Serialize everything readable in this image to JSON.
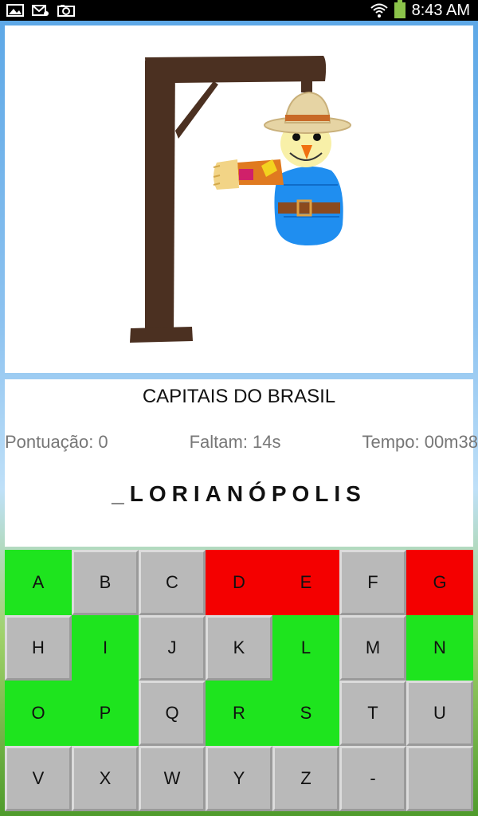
{
  "status_bar": {
    "time": "8:43 AM",
    "icons": [
      "image-icon",
      "mail-icon",
      "camera-icon",
      "wifi-icon",
      "battery-icon"
    ]
  },
  "game": {
    "category": "CAPITAIS DO BRASIL",
    "score_label": "Pontuação: 0",
    "remaining_label": "Faltam: 14s",
    "time_label": "Tempo: 00m38",
    "word": "_LORIANÓPOLIS"
  },
  "colors": {
    "correct": "#1ee41e",
    "wrong": "#f40000",
    "unused": "#b9b9b9"
  },
  "keyboard": {
    "keys": [
      {
        "label": "A",
        "state": "correct"
      },
      {
        "label": "B",
        "state": "unused"
      },
      {
        "label": "C",
        "state": "unused"
      },
      {
        "label": "D",
        "state": "wrong"
      },
      {
        "label": "E",
        "state": "wrong"
      },
      {
        "label": "F",
        "state": "unused"
      },
      {
        "label": "G",
        "state": "wrong"
      },
      {
        "label": "H",
        "state": "unused"
      },
      {
        "label": "I",
        "state": "correct"
      },
      {
        "label": "J",
        "state": "unused"
      },
      {
        "label": "K",
        "state": "unused"
      },
      {
        "label": "L",
        "state": "correct"
      },
      {
        "label": "M",
        "state": "unused"
      },
      {
        "label": "N",
        "state": "correct"
      },
      {
        "label": "O",
        "state": "correct"
      },
      {
        "label": "P",
        "state": "correct"
      },
      {
        "label": "Q",
        "state": "unused"
      },
      {
        "label": "R",
        "state": "correct"
      },
      {
        "label": "S",
        "state": "correct"
      },
      {
        "label": "T",
        "state": "unused"
      },
      {
        "label": "U",
        "state": "unused"
      },
      {
        "label": "V",
        "state": "unused"
      },
      {
        "label": "X",
        "state": "unused"
      },
      {
        "label": "W",
        "state": "unused"
      },
      {
        "label": "Y",
        "state": "unused"
      },
      {
        "label": "Z",
        "state": "unused"
      },
      {
        "label": "-",
        "state": "unused"
      },
      {
        "label": "",
        "state": "unused"
      }
    ]
  }
}
